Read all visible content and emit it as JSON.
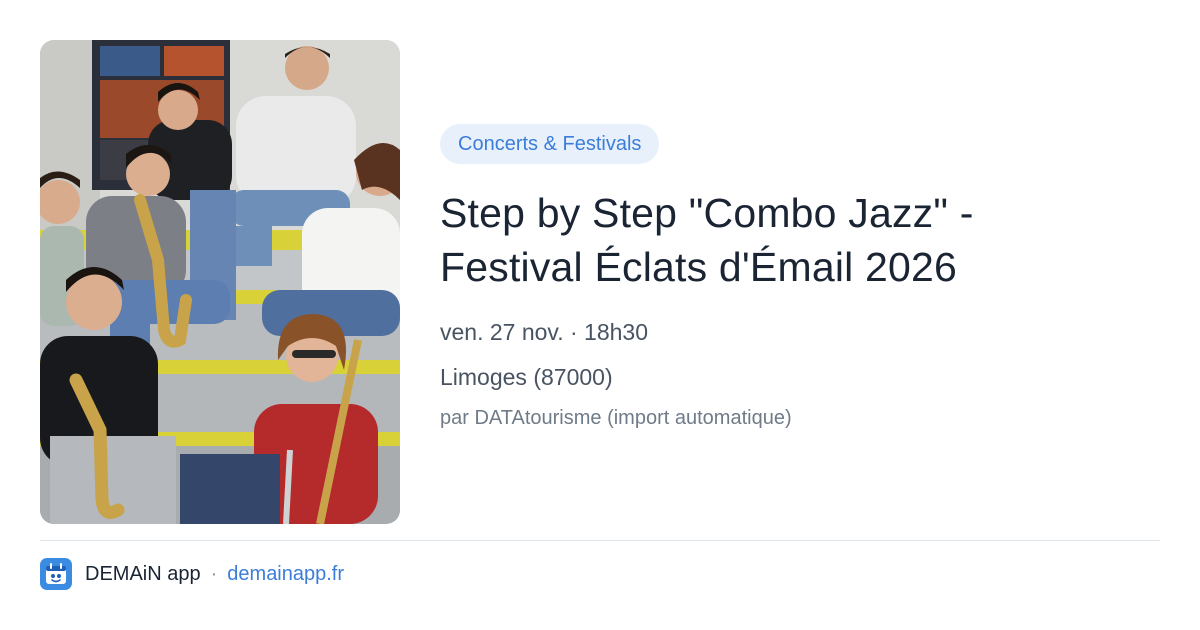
{
  "event": {
    "category": "Concerts & Festivals",
    "title_line1": "Step by Step \"Combo Jazz\" -",
    "title_line2": "Festival Éclats d'Émail 2026",
    "datetime": "ven. 27 nov. · 18h30",
    "location": "Limoges (87000)",
    "source": "par DATAtourisme (import automatique)"
  },
  "footer": {
    "app_icon": "demain-app-icon",
    "app_name": "DEMAiN app",
    "separator": "·",
    "domain": "demainapp.fr"
  }
}
